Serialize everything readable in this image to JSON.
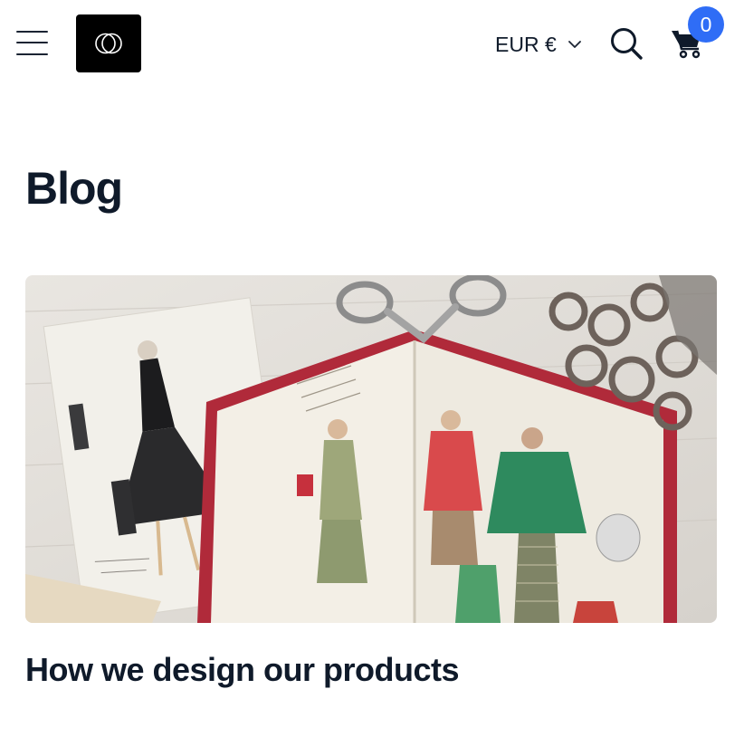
{
  "header": {
    "menu_icon": "hamburger-menu-icon",
    "logo_icon": "interlocking-circles-logo",
    "currency_label": "EUR €",
    "currency_icon": "chevron-down-icon",
    "search_icon": "search-icon",
    "cart_icon": "shopping-cart-icon",
    "cart_count": "0"
  },
  "main": {
    "page_title": "Blog",
    "posts": [
      {
        "image_description_icon": "fashion-illustrations-photo",
        "title": "How we design our products"
      }
    ]
  },
  "colors": {
    "badge": "#2f6df6",
    "logo_bg": "#000000",
    "text": "#0f1a2a"
  }
}
